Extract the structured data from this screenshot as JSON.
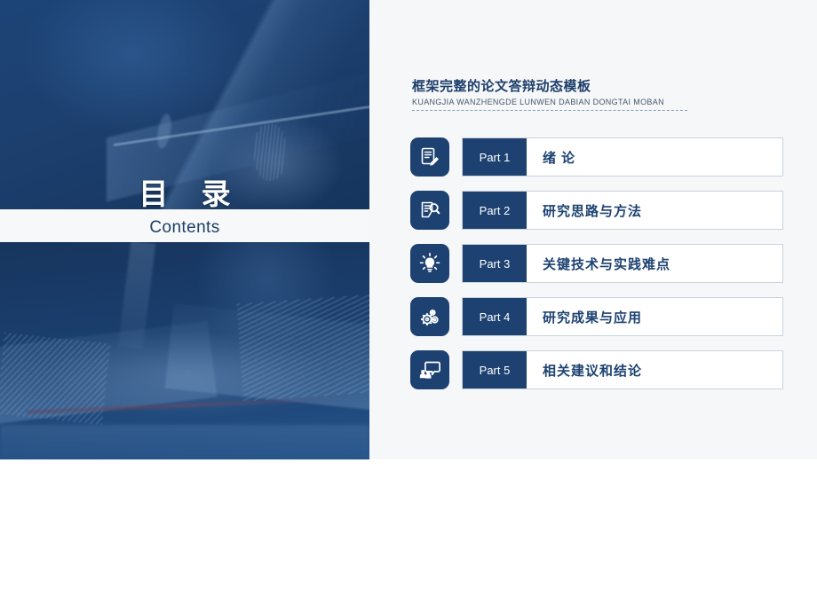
{
  "left": {
    "title_cn": "目 录",
    "title_en": "Contents",
    "photo_top_alt": "graduation-cap-photo",
    "photo_bottom_alt": "open-book-photo"
  },
  "right": {
    "heading_cn": "框架完整的论文答辩动态模板",
    "heading_en": "KUANGJIA WANZHENGDE LUNWEN DABIAN DONGTAI MOBAN",
    "items": [
      {
        "tag": "Part 1",
        "label": "绪  论",
        "icon": "document-pen-icon"
      },
      {
        "tag": "Part 2",
        "label": "研究思路与方法",
        "icon": "document-search-icon"
      },
      {
        "tag": "Part 3",
        "label": "关键技术与实践难点",
        "icon": "lightbulb-icon"
      },
      {
        "tag": "Part 4",
        "label": "研究成果与应用",
        "icon": "gears-icon"
      },
      {
        "tag": "Part 5",
        "label": "相关建议和结论",
        "icon": "people-speech-icon"
      }
    ]
  },
  "colors": {
    "navy": "#1d4272",
    "panel_bg": "#f6f7f8",
    "text_blue": "#1d3f6b",
    "border": "#c9d3dd"
  }
}
